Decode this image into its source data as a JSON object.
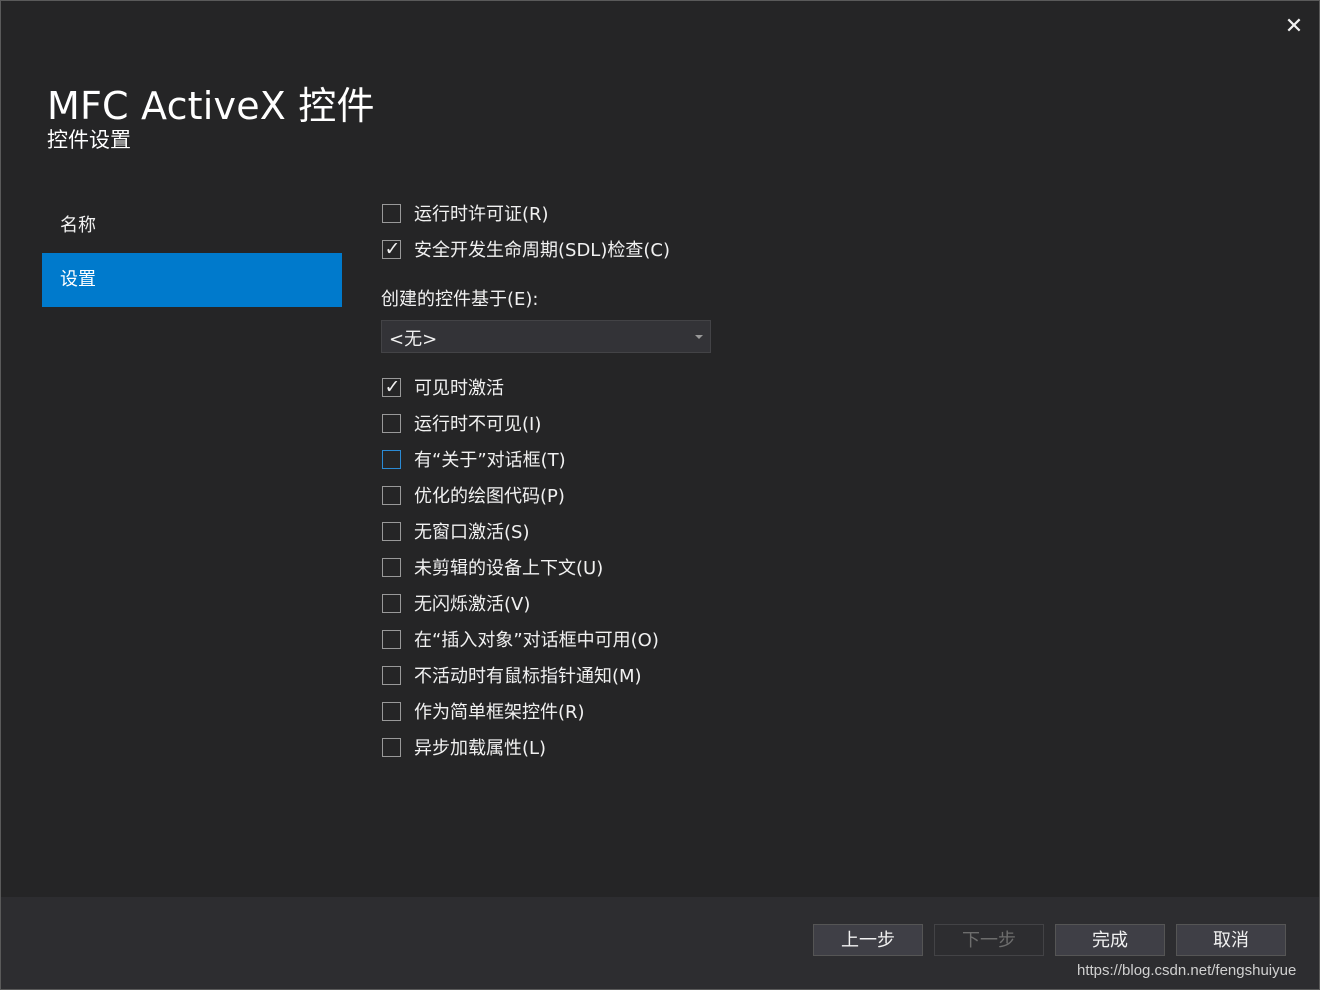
{
  "window": {
    "title": "MFC ActiveX 控件",
    "subtitle": "控件设置",
    "close_glyph": "✕"
  },
  "nav": {
    "items": [
      {
        "label": "名称",
        "selected": false
      },
      {
        "label": "设置",
        "selected": true
      }
    ]
  },
  "settings": {
    "top_checkboxes": [
      {
        "label": "运行时许可证(R)",
        "checked": false
      },
      {
        "label": "安全开发生命周期(SDL)检查(C)",
        "checked": true
      }
    ],
    "dropdown_label": "创建的控件基于(E):",
    "dropdown_value": "<无>",
    "options": [
      {
        "label": "可见时激活",
        "checked": true
      },
      {
        "label": "运行时不可见(I)",
        "checked": false
      },
      {
        "label": "有“关于”对话框(T)",
        "checked": false,
        "focused": true
      },
      {
        "label": "优化的绘图代码(P)",
        "checked": false
      },
      {
        "label": "无窗口激活(S)",
        "checked": false
      },
      {
        "label": "未剪辑的设备上下文(U)",
        "checked": false
      },
      {
        "label": "无闪烁激活(V)",
        "checked": false
      },
      {
        "label": "在“插入对象”对话框中可用(O)",
        "checked": false
      },
      {
        "label": "不活动时有鼠标指针通知(M)",
        "checked": false
      },
      {
        "label": "作为简单框架控件(R)",
        "checked": false
      },
      {
        "label": "异步加载属性(L)",
        "checked": false
      }
    ]
  },
  "footer": {
    "prev_label": "上一步",
    "next_label": "下一步",
    "finish_label": "完成",
    "cancel_label": "取消"
  },
  "watermark": "https://blog.csdn.net/fengshuiyue",
  "colors": {
    "background": "#252526",
    "accent": "#007acc",
    "footer": "#2d2d30"
  }
}
